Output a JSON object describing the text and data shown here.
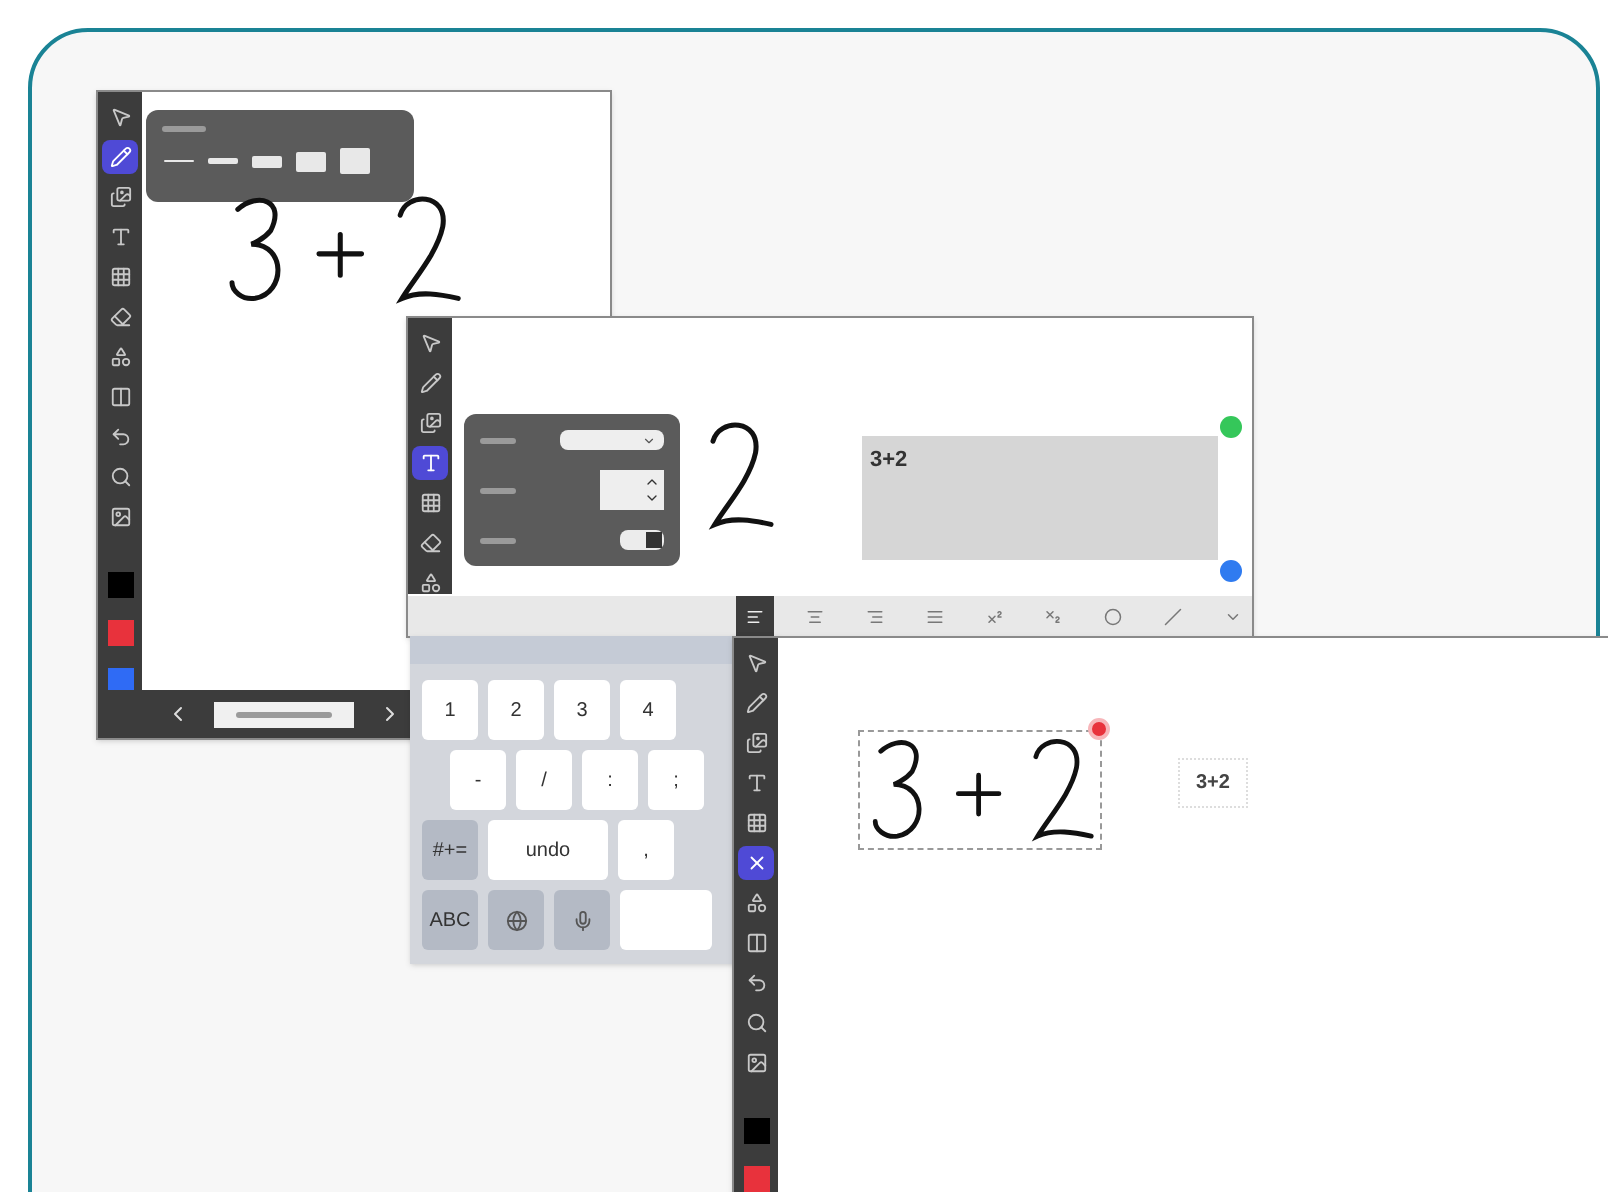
{
  "board_1": {
    "tools": [
      {
        "kind": "tool",
        "selected": false
      },
      {
        "kind": "tool",
        "selected": true
      },
      {
        "kind": "tool",
        "selected": false
      },
      {
        "kind": "tool",
        "selected": false
      },
      {
        "kind": "tool",
        "selected": false
      },
      {
        "kind": "tool",
        "selected": false
      },
      {
        "kind": "tool",
        "selected": false
      },
      {
        "kind": "tool",
        "selected": false
      },
      {
        "kind": "tool",
        "selected": false
      },
      {
        "kind": "tool",
        "selected": false
      },
      {
        "kind": "tool",
        "selected": false
      },
      {
        "kind": "swatch",
        "color": "#000000"
      },
      {
        "kind": "swatch",
        "color": "#e8323c"
      },
      {
        "kind": "swatch",
        "color": "#2f6bf5"
      }
    ],
    "stroke_popup": {
      "widths": [
        {
          "selected": false
        },
        {
          "selected": false
        },
        {
          "selected": false
        },
        {
          "selected": false
        },
        {
          "selected": false
        }
      ]
    }
  },
  "board_2": {
    "tools": [
      {
        "kind": "tool",
        "selected": false
      },
      {
        "kind": "tool",
        "selected": false
      },
      {
        "kind": "tool",
        "selected": false
      },
      {
        "kind": "tool",
        "selected": true
      },
      {
        "kind": "tool",
        "selected": false
      },
      {
        "kind": "tool",
        "selected": false
      },
      {
        "kind": "tool",
        "selected": false
      }
    ],
    "text_popup": {
      "toggle": {
        "on": true
      }
    },
    "text_box": "3+2",
    "format_bar": [
      {
        "selected": true
      },
      {
        "selected": false
      },
      {
        "selected": false
      },
      {
        "selected": false
      },
      {
        "selected": false
      },
      {
        "selected": false
      },
      {
        "selected": false
      },
      {
        "selected": false
      },
      {
        "selected": false
      }
    ]
  },
  "keyboard": {
    "rows": [
      [
        {
          "kind": "key",
          "label": "1"
        },
        {
          "kind": "key",
          "label": "2"
        },
        {
          "kind": "key",
          "label": "3"
        },
        {
          "kind": "key",
          "label": "4"
        }
      ],
      [
        {
          "kind": "key",
          "label": "-"
        },
        {
          "kind": "key",
          "label": "/"
        },
        {
          "kind": "key",
          "label": ":"
        },
        {
          "kind": "key",
          "label": ";"
        }
      ],
      [
        {
          "kind": "function",
          "label": "#+="
        },
        {
          "kind": "wide",
          "label": "undo"
        },
        {
          "kind": "key",
          "label": ","
        }
      ],
      [
        {
          "kind": "function",
          "label": "ABC"
        },
        {
          "kind": "globe"
        },
        {
          "kind": "mic"
        },
        {
          "kind": "space"
        }
      ]
    ]
  },
  "board_3": {
    "tools": [
      {
        "kind": "tool",
        "selected": false
      },
      {
        "kind": "tool",
        "selected": false
      },
      {
        "kind": "tool",
        "selected": false
      },
      {
        "kind": "tool",
        "selected": false
      },
      {
        "kind": "tool",
        "selected": false
      },
      {
        "kind": "tool",
        "selected": true
      },
      {
        "kind": "tool",
        "selected": false
      },
      {
        "kind": "tool",
        "selected": false
      },
      {
        "kind": "tool",
        "selected": false
      },
      {
        "kind": "tool",
        "selected": false
      },
      {
        "kind": "tool",
        "selected": false
      },
      {
        "kind": "swatch",
        "color": "#000000"
      },
      {
        "kind": "swatch",
        "color": "#e8323c"
      }
    ],
    "text_label": "3+2"
  }
}
